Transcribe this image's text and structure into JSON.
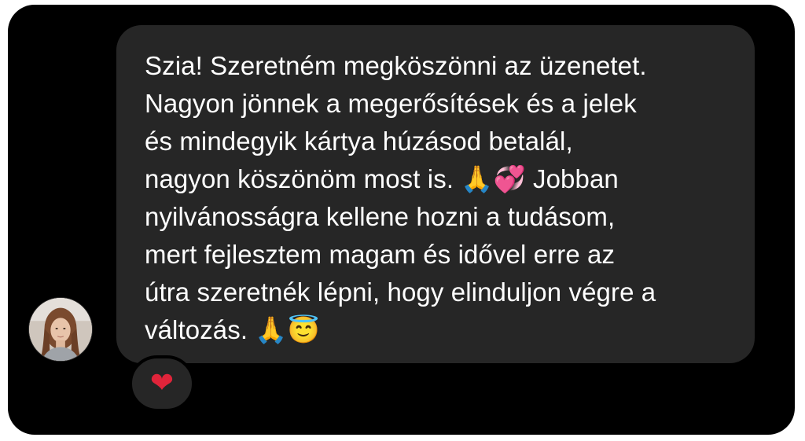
{
  "message": {
    "text": "Szia! Szeretném megköszönni az üzenetet.\nNagyon jönnek a megerősítések és a jelek\nés mindegyik kártya húzásod betalál,\nnagyon köszönöm most is. 🙏💞 Jobban\nnyilvánosságra kellene hozni a tudásom,\nmert fejlesztem magam és idővel erre az\nútra szeretnék lépni, hogy elinduljon végre a\nváltozás. 🙏😇"
  },
  "reaction": {
    "emoji": "❤"
  },
  "colors": {
    "background": "#000000",
    "bubble": "#262626",
    "text": "#ffffff",
    "heart": "#e0243a"
  },
  "icons": {
    "avatar": "profile-photo",
    "reaction": "red-heart-icon"
  }
}
